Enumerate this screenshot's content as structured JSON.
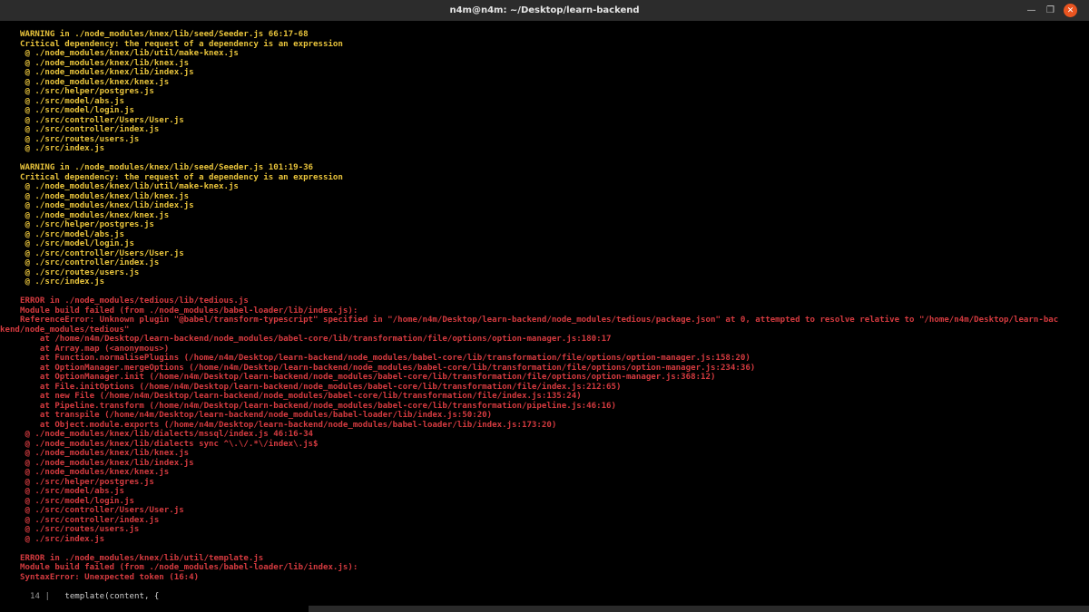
{
  "window": {
    "title": "n4m@n4m: ~/Desktop/learn-backend",
    "minimize_icon": "minimize-icon",
    "maximize_icon": "restore-icon",
    "close_icon": "close-icon"
  },
  "colors": {
    "warning": "#e8c33b",
    "error": "#d43a3f",
    "titlebar": "#2c2c2c",
    "close": "#e95420"
  },
  "terminal": {
    "lines": [
      {
        "t": "WARNING in ./node_modules/knex/lib/seed/Seeder.js 66:17-68",
        "c": "y"
      },
      {
        "t": "Critical dependency: the request of a dependency is an expression",
        "c": "y"
      },
      {
        "t": " @ ./node_modules/knex/lib/util/make-knex.js",
        "c": "y"
      },
      {
        "t": " @ ./node_modules/knex/lib/knex.js",
        "c": "y"
      },
      {
        "t": " @ ./node_modules/knex/lib/index.js",
        "c": "y"
      },
      {
        "t": " @ ./node_modules/knex/knex.js",
        "c": "y"
      },
      {
        "t": " @ ./src/helper/postgres.js",
        "c": "y"
      },
      {
        "t": " @ ./src/model/abs.js",
        "c": "y"
      },
      {
        "t": " @ ./src/model/login.js",
        "c": "y"
      },
      {
        "t": " @ ./src/controller/Users/User.js",
        "c": "y"
      },
      {
        "t": " @ ./src/controller/index.js",
        "c": "y"
      },
      {
        "t": " @ ./src/routes/users.js",
        "c": "y"
      },
      {
        "t": " @ ./src/index.js",
        "c": "y"
      },
      {
        "t": "",
        "c": "y"
      },
      {
        "t": "WARNING in ./node_modules/knex/lib/seed/Seeder.js 101:19-36",
        "c": "y"
      },
      {
        "t": "Critical dependency: the request of a dependency is an expression",
        "c": "y"
      },
      {
        "t": " @ ./node_modules/knex/lib/util/make-knex.js",
        "c": "y"
      },
      {
        "t": " @ ./node_modules/knex/lib/knex.js",
        "c": "y"
      },
      {
        "t": " @ ./node_modules/knex/lib/index.js",
        "c": "y"
      },
      {
        "t": " @ ./node_modules/knex/knex.js",
        "c": "y"
      },
      {
        "t": " @ ./src/helper/postgres.js",
        "c": "y"
      },
      {
        "t": " @ ./src/model/abs.js",
        "c": "y"
      },
      {
        "t": " @ ./src/model/login.js",
        "c": "y"
      },
      {
        "t": " @ ./src/controller/Users/User.js",
        "c": "y"
      },
      {
        "t": " @ ./src/controller/index.js",
        "c": "y"
      },
      {
        "t": " @ ./src/routes/users.js",
        "c": "y"
      },
      {
        "t": " @ ./src/index.js",
        "c": "y"
      },
      {
        "t": "",
        "c": "y"
      },
      {
        "t": "ERROR in ./node_modules/tedious/lib/tedious.js",
        "c": "r"
      },
      {
        "t": "Module build failed (from ./node_modules/babel-loader/lib/index.js):",
        "c": "r"
      },
      {
        "t": "ReferenceError: Unknown plugin \"@babel/transform-typescript\" specified in \"/home/n4m/Desktop/learn-backend/node_modules/tedious/package.json\" at 0, attempted to resolve relative to \"/home/n4m/Desktop/learn-bac",
        "c": "r"
      },
      {
        "t": "kend/node_modules/tedious\"",
        "c": "r",
        "noind": true
      },
      {
        "t": "    at /home/n4m/Desktop/learn-backend/node_modules/babel-core/lib/transformation/file/options/option-manager.js:180:17",
        "c": "r"
      },
      {
        "t": "    at Array.map (<anonymous>)",
        "c": "r"
      },
      {
        "t": "    at Function.normalisePlugins (/home/n4m/Desktop/learn-backend/node_modules/babel-core/lib/transformation/file/options/option-manager.js:158:20)",
        "c": "r"
      },
      {
        "t": "    at OptionManager.mergeOptions (/home/n4m/Desktop/learn-backend/node_modules/babel-core/lib/transformation/file/options/option-manager.js:234:36)",
        "c": "r"
      },
      {
        "t": "    at OptionManager.init (/home/n4m/Desktop/learn-backend/node_modules/babel-core/lib/transformation/file/options/option-manager.js:368:12)",
        "c": "r"
      },
      {
        "t": "    at File.initOptions (/home/n4m/Desktop/learn-backend/node_modules/babel-core/lib/transformation/file/index.js:212:65)",
        "c": "r"
      },
      {
        "t": "    at new File (/home/n4m/Desktop/learn-backend/node_modules/babel-core/lib/transformation/file/index.js:135:24)",
        "c": "r"
      },
      {
        "t": "    at Pipeline.transform (/home/n4m/Desktop/learn-backend/node_modules/babel-core/lib/transformation/pipeline.js:46:16)",
        "c": "r"
      },
      {
        "t": "    at transpile (/home/n4m/Desktop/learn-backend/node_modules/babel-loader/lib/index.js:50:20)",
        "c": "r"
      },
      {
        "t": "    at Object.module.exports (/home/n4m/Desktop/learn-backend/node_modules/babel-loader/lib/index.js:173:20)",
        "c": "r"
      },
      {
        "t": " @ ./node_modules/knex/lib/dialects/mssql/index.js 46:16-34",
        "c": "r"
      },
      {
        "t": " @ ./node_modules/knex/lib/dialects sync ^\\.\\/.*\\/index\\.js$",
        "c": "r"
      },
      {
        "t": " @ ./node_modules/knex/lib/knex.js",
        "c": "r"
      },
      {
        "t": " @ ./node_modules/knex/lib/index.js",
        "c": "r"
      },
      {
        "t": " @ ./node_modules/knex/knex.js",
        "c": "r"
      },
      {
        "t": " @ ./src/helper/postgres.js",
        "c": "r"
      },
      {
        "t": " @ ./src/model/abs.js",
        "c": "r"
      },
      {
        "t": " @ ./src/model/login.js",
        "c": "r"
      },
      {
        "t": " @ ./src/controller/Users/User.js",
        "c": "r"
      },
      {
        "t": " @ ./src/controller/index.js",
        "c": "r"
      },
      {
        "t": " @ ./src/routes/users.js",
        "c": "r"
      },
      {
        "t": " @ ./src/index.js",
        "c": "r"
      },
      {
        "t": "",
        "c": "r"
      },
      {
        "t": "ERROR in ./node_modules/knex/lib/util/template.js",
        "c": "r"
      },
      {
        "t": "Module build failed (from ./node_modules/babel-loader/lib/index.js):",
        "c": "r"
      },
      {
        "t": "SyntaxError: Unexpected token (16:4)",
        "c": "r"
      },
      {
        "t": "",
        "c": "r"
      }
    ],
    "code_line": {
      "number": "14",
      "separator": "|",
      "code": "  template(content, {"
    }
  }
}
